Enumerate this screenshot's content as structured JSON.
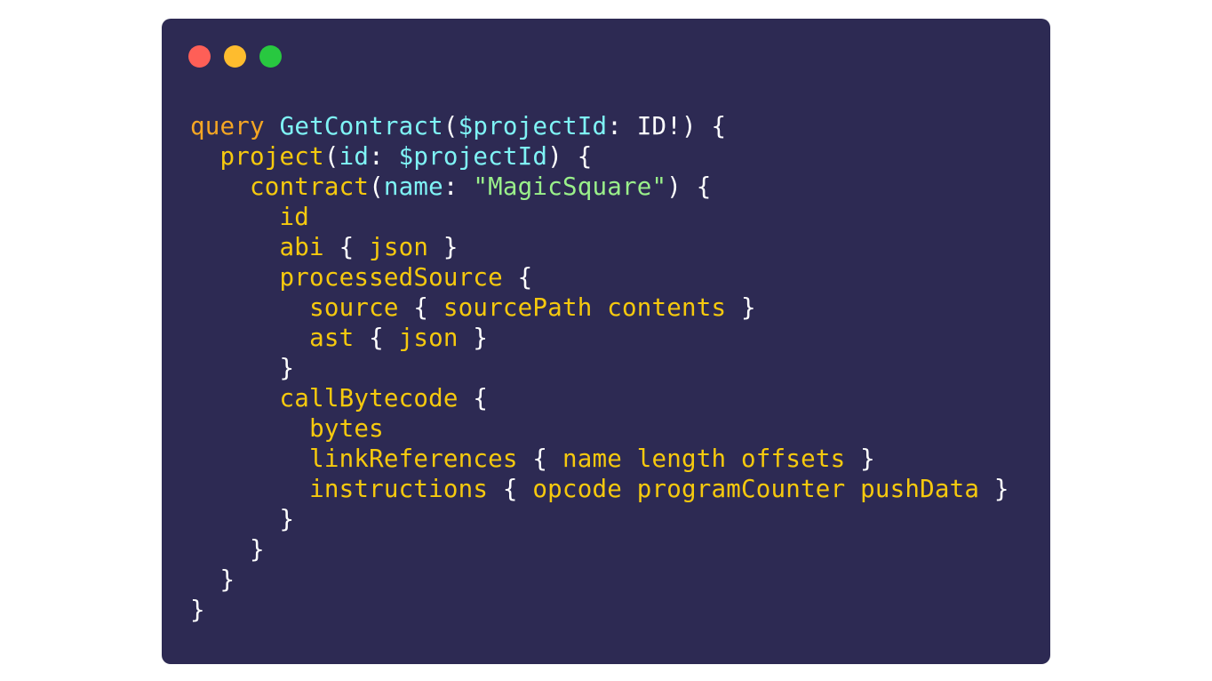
{
  "window": {
    "background": "#2d2a53",
    "traffic_lights": [
      {
        "name": "close",
        "color": "#fe5f57"
      },
      {
        "name": "minimize",
        "color": "#febc2e"
      },
      {
        "name": "zoom",
        "color": "#28c840"
      }
    ]
  },
  "colors": {
    "keyword": "#f5a623",
    "operation": "#7ff3f5",
    "field": "#f6c90e",
    "variable": "#7ff3f5",
    "argument": "#7ff3f5",
    "string": "#9af08a",
    "punct": "#ffffff"
  },
  "code_lines": [
    [
      [
        "keyword",
        "query"
      ],
      [
        "punct",
        " "
      ],
      [
        "operation",
        "GetContract"
      ],
      [
        "punct",
        "("
      ],
      [
        "variable",
        "$projectId"
      ],
      [
        "punct",
        ": ID!) {"
      ]
    ],
    [
      [
        "punct",
        "  "
      ],
      [
        "field",
        "project"
      ],
      [
        "punct",
        "("
      ],
      [
        "argument",
        "id"
      ],
      [
        "punct",
        ": "
      ],
      [
        "variable",
        "$projectId"
      ],
      [
        "punct",
        ") {"
      ]
    ],
    [
      [
        "punct",
        "    "
      ],
      [
        "field",
        "contract"
      ],
      [
        "punct",
        "("
      ],
      [
        "argument",
        "name"
      ],
      [
        "punct",
        ": "
      ],
      [
        "string",
        "\"MagicSquare\""
      ],
      [
        "punct",
        ") {"
      ]
    ],
    [
      [
        "punct",
        "      "
      ],
      [
        "field",
        "id"
      ]
    ],
    [
      [
        "punct",
        "      "
      ],
      [
        "field",
        "abi"
      ],
      [
        "punct",
        " { "
      ],
      [
        "field",
        "json"
      ],
      [
        "punct",
        " }"
      ]
    ],
    [
      [
        "punct",
        "      "
      ],
      [
        "field",
        "processedSource"
      ],
      [
        "punct",
        " {"
      ]
    ],
    [
      [
        "punct",
        "        "
      ],
      [
        "field",
        "source"
      ],
      [
        "punct",
        " { "
      ],
      [
        "field",
        "sourcePath"
      ],
      [
        "punct",
        " "
      ],
      [
        "field",
        "contents"
      ],
      [
        "punct",
        " }"
      ]
    ],
    [
      [
        "punct",
        "        "
      ],
      [
        "field",
        "ast"
      ],
      [
        "punct",
        " { "
      ],
      [
        "field",
        "json"
      ],
      [
        "punct",
        " }"
      ]
    ],
    [
      [
        "punct",
        "      }"
      ]
    ],
    [
      [
        "punct",
        "      "
      ],
      [
        "field",
        "callBytecode"
      ],
      [
        "punct",
        " {"
      ]
    ],
    [
      [
        "punct",
        "        "
      ],
      [
        "field",
        "bytes"
      ]
    ],
    [
      [
        "punct",
        "        "
      ],
      [
        "field",
        "linkReferences"
      ],
      [
        "punct",
        " { "
      ],
      [
        "field",
        "name"
      ],
      [
        "punct",
        " "
      ],
      [
        "field",
        "length"
      ],
      [
        "punct",
        " "
      ],
      [
        "field",
        "offsets"
      ],
      [
        "punct",
        " }"
      ]
    ],
    [
      [
        "punct",
        "        "
      ],
      [
        "field",
        "instructions"
      ],
      [
        "punct",
        " { "
      ],
      [
        "field",
        "opcode"
      ],
      [
        "punct",
        " "
      ],
      [
        "field",
        "programCounter"
      ],
      [
        "punct",
        " "
      ],
      [
        "field",
        "pushData"
      ],
      [
        "punct",
        " }"
      ]
    ],
    [
      [
        "punct",
        "      }"
      ]
    ],
    [
      [
        "punct",
        "    }"
      ]
    ],
    [
      [
        "punct",
        "  }"
      ]
    ],
    [
      [
        "punct",
        "}"
      ]
    ]
  ]
}
